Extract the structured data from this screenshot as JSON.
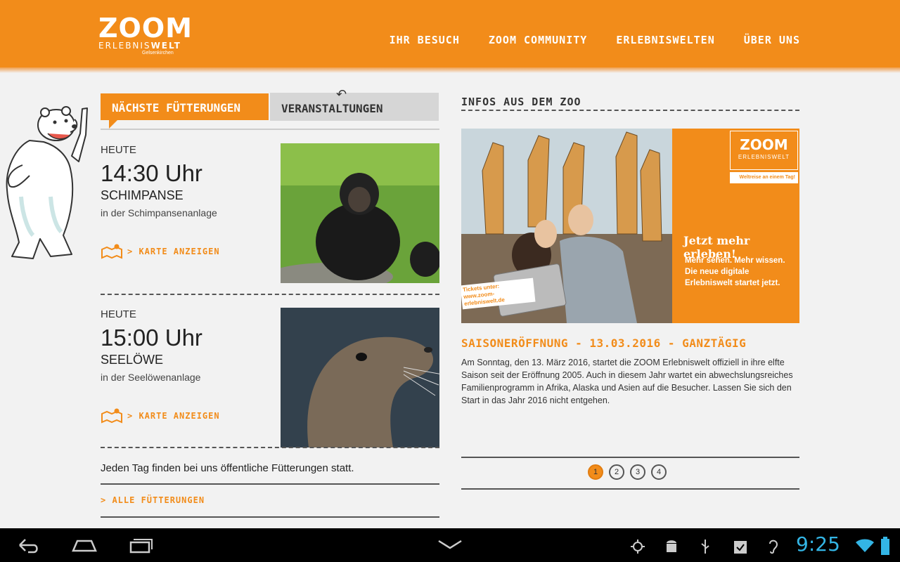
{
  "header": {
    "logo_main": "ZOOM",
    "logo_sub_light": "ERLEBNIS",
    "logo_sub_bold": "WELT",
    "logo_city": "Gelsenkirchen",
    "nav": [
      "IHR BESUCH",
      "ZOOM COMMUNITY",
      "ERLEBNISWELTEN",
      "ÜBER UNS"
    ]
  },
  "tabs": {
    "active": "NÄCHSTE FÜTTERUNGEN",
    "inactive": "VERANSTALTUNGEN"
  },
  "feedings": [
    {
      "day": "HEUTE",
      "time": "14:30 Uhr",
      "animal": "SCHIMPANSE",
      "place": "in der Schimpansenanlage",
      "map_link": "> KARTE ANZEIGEN"
    },
    {
      "day": "HEUTE",
      "time": "15:00 Uhr",
      "animal": "SEELÖWE",
      "place": "in der Seelöwenanlage",
      "map_link": "> KARTE ANZEIGEN"
    }
  ],
  "daily_note": "Jeden Tag finden bei uns öffentliche Fütterungen statt.",
  "all_feedings_link": "> ALLE FÜTTERUNGEN",
  "info": {
    "title": "INFOS AUS DEM ZOO",
    "banner": {
      "logo_main": "ZOOM",
      "logo_sub": "ERLEBNISWELT",
      "tag": "Weltreise an einem Tag!",
      "headline": "Jetzt mehr erleben!",
      "copy_lines": [
        "Mehr sehen. Mehr wissen.",
        "Die neue digitale",
        "Erlebniswelt startet jetzt."
      ],
      "tickets_line1": "Tickets unter:",
      "tickets_line2": "www.zoom-erlebniswelt.de"
    },
    "news_title": "SAISONERÖFFNUNG - 13.03.2016 - GANZTÄGIG",
    "news_body": "Am Sonntag, den 13. März 2016, startet die ZOOM Erlebniswelt offiziell in ihre elfte Saison seit der Eröffnung 2005. Auch in diesem Jahr wartet ein abwechslungsreiches Familienprogramm in Afrika, Alaska und Asien auf die Besucher. Lassen Sie sich den Start in das Jahr 2016 nicht entgehen.",
    "pages": [
      "1",
      "2",
      "3",
      "4"
    ],
    "current_page": "1"
  },
  "system": {
    "clock": "9:25",
    "icons": [
      "back-icon",
      "home-icon",
      "recents-icon",
      "keyboard-hide-icon",
      "gps-icon",
      "android-debug-icon",
      "usb-icon",
      "clipboard-check-icon",
      "hearing-icon",
      "wifi-icon",
      "battery-icon"
    ]
  },
  "colors": {
    "brand_orange": "#f28c1a",
    "clock_blue": "#33b5e5"
  }
}
